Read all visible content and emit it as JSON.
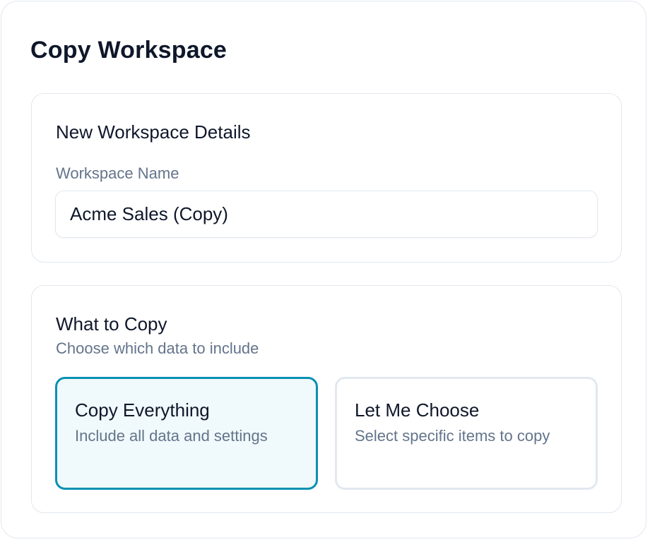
{
  "dialog": {
    "title": "Copy Workspace"
  },
  "details": {
    "heading": "New Workspace Details",
    "name_label": "Workspace Name",
    "name_value": "Acme Sales (Copy)"
  },
  "copy_options": {
    "heading": "What to Copy",
    "subheading": "Choose which data to include",
    "selected": "copy-everything",
    "accent_color": "#0891b2",
    "options": [
      {
        "title": "Copy Everything",
        "description": "Include all data and settings"
      },
      {
        "title": "Let Me Choose",
        "description": "Select specific items to copy"
      }
    ]
  }
}
